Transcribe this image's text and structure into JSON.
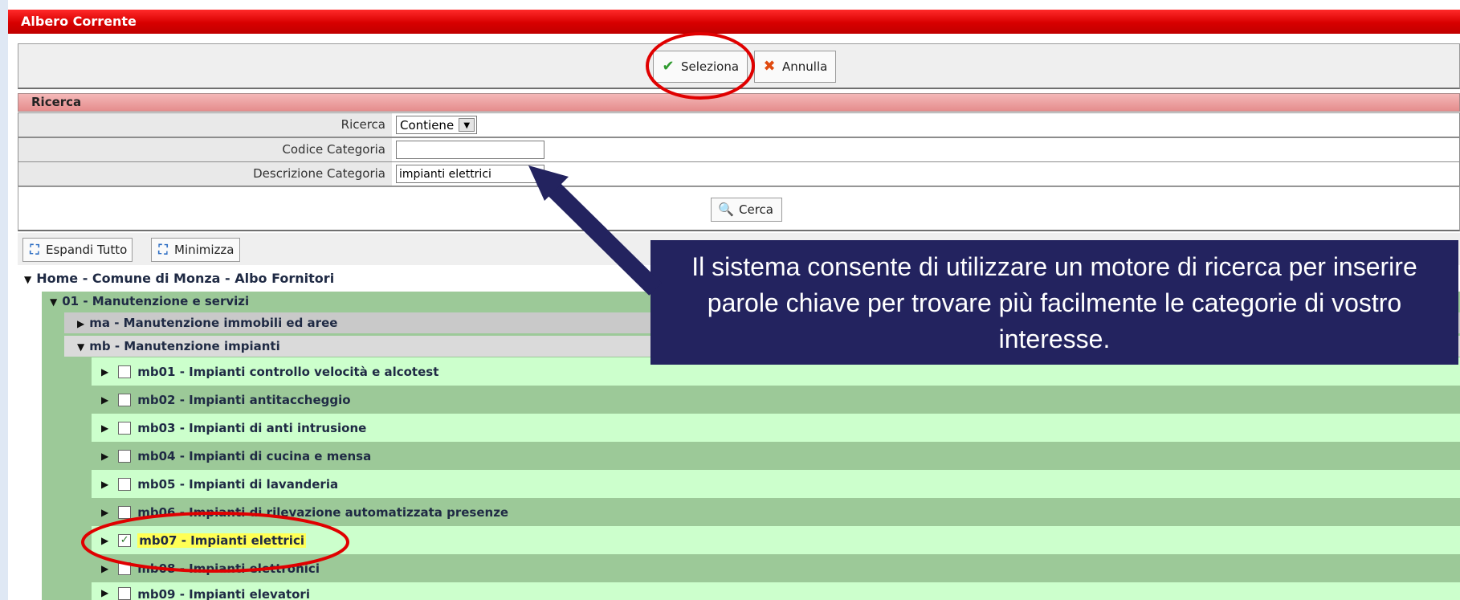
{
  "window": {
    "title": "Albero Corrente"
  },
  "toolbar": {
    "select_label": "Seleziona",
    "cancel_label": "Annulla"
  },
  "search": {
    "section_title": "Ricerca",
    "mode_label": "Ricerca",
    "mode_value": "Contiene",
    "code_label": "Codice Categoria",
    "code_value": "",
    "desc_label": "Descrizione Categoria",
    "desc_value": "impianti elettrici",
    "search_button": "Cerca"
  },
  "tree_toolbar": {
    "expand_label": "Espandi Tutto",
    "collapse_label": "Minimizza"
  },
  "tree": {
    "root": "Home - Comune di Monza - Albo Fornitori",
    "level1": "01 - Manutenzione e servizi",
    "groups": [
      "ma - Manutenzione immobili ed aree",
      "mb - Manutenzione impianti"
    ],
    "items": [
      {
        "label": "mb01 - Impianti controllo velocità e alcotest",
        "checked": false
      },
      {
        "label": "mb02 - Impianti antitaccheggio",
        "checked": false
      },
      {
        "label": "mb03 - Impianti di anti intrusione",
        "checked": false
      },
      {
        "label": "mb04 - Impianti di cucina e mensa",
        "checked": false
      },
      {
        "label": "mb05 - Impianti di lavanderia",
        "checked": false
      },
      {
        "label": "mb06 - Impianti di rilevazione automatizzata presenze",
        "checked": false
      },
      {
        "label": "mb07 - Impianti elettrici",
        "checked": true
      },
      {
        "label": "mb08 - Impianti elettronici",
        "checked": false
      },
      {
        "label": "mb09 - Impianti elevatori",
        "checked": false
      }
    ]
  },
  "callout": {
    "text": "Il sistema consente di utilizzare un motore di ricerca per inserire parole chiave per trovare più facilmente le categorie di vostro interesse."
  },
  "colors": {
    "title_red": "#d80000",
    "callout_navy": "#23235f",
    "annotation_red": "#e00000",
    "tree_green": "#9cc998",
    "tree_light": "#ccffcc"
  }
}
